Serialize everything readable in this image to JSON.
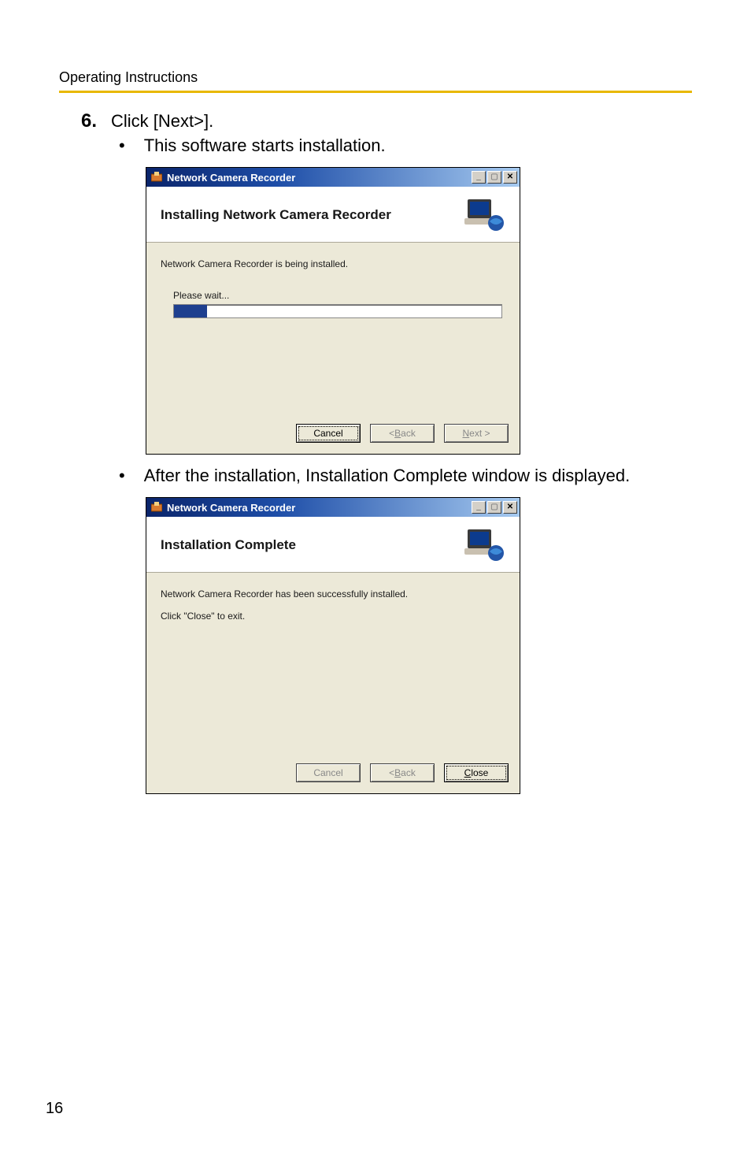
{
  "page": {
    "header": "Operating Instructions",
    "pageNumber": "16"
  },
  "step": {
    "number": "6.",
    "text": "Click [Next>]."
  },
  "bullets": [
    "This software starts installation.",
    "After the installation, Installation Complete window is displayed."
  ],
  "dialog1": {
    "title": "Network Camera Recorder",
    "heading": "Installing Network Camera Recorder",
    "bodyLine1": "Network Camera Recorder is being installed.",
    "progressLabel": "Please wait...",
    "buttons": {
      "cancel": "Cancel",
      "back": "Back",
      "next": "Next >"
    }
  },
  "dialog2": {
    "title": "Network Camera Recorder",
    "heading": "Installation Complete",
    "bodyLine1": "Network Camera Recorder has been successfully installed.",
    "bodyLine2": "Click \"Close\" to exit.",
    "buttons": {
      "cancel": "Cancel",
      "back": "Back",
      "close": "Close"
    }
  }
}
